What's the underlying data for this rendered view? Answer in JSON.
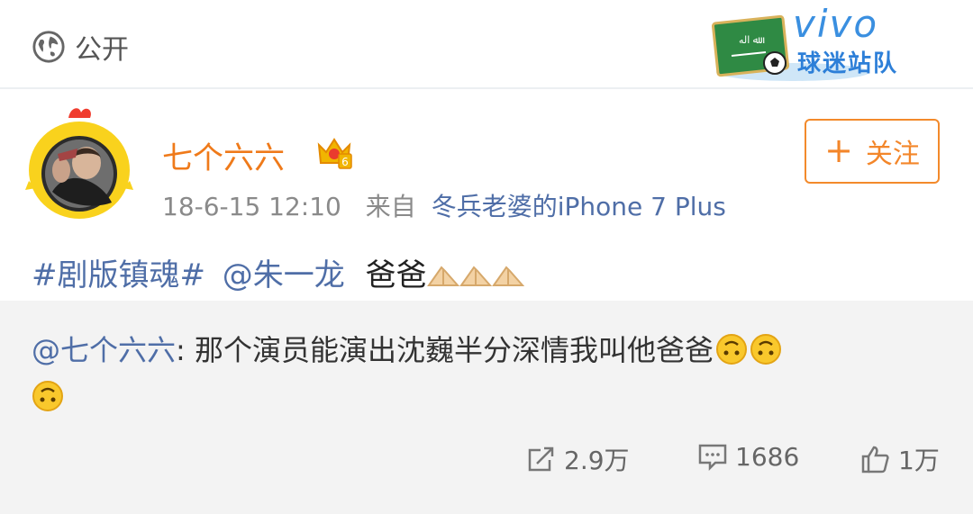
{
  "header": {
    "visibility_label": "公开",
    "badge": {
      "brand": "vivo",
      "subtitle": "球迷站队"
    }
  },
  "post": {
    "username": "七个六六",
    "vip_level": "6",
    "timestamp": "18-6-15 12:10",
    "source_prefix": "来自",
    "source_device": "冬兵老婆的iPhone 7 Plus",
    "follow_label": "关注",
    "topic": "#剧版镇魂#",
    "mention": "@朱一龙",
    "text": "爸爸"
  },
  "repost": {
    "author": "@七个六六",
    "separator": ":",
    "text": " 那个演员能演出沈巍半分深情我叫他爸爸"
  },
  "actions": {
    "repost_count": "2.9万",
    "comment_count": "1686",
    "like_count": "1万"
  }
}
